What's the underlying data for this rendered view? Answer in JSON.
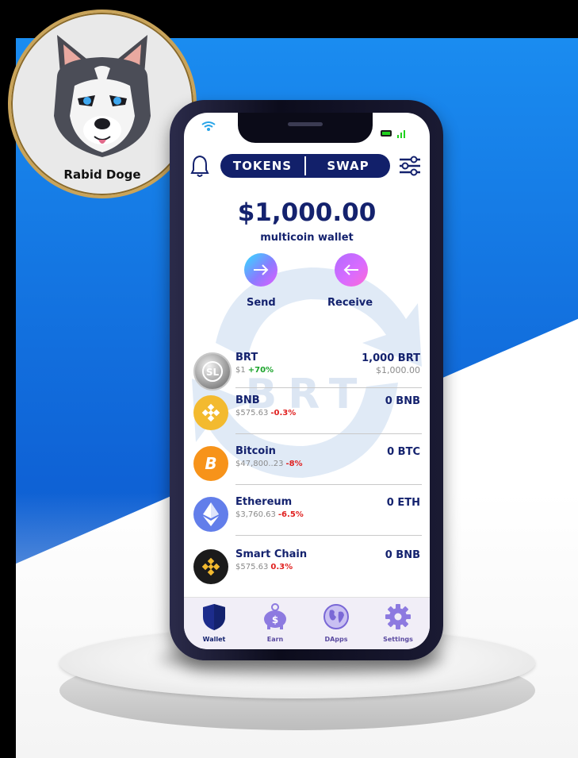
{
  "brand": {
    "logo_text": "Rabid Doge"
  },
  "header": {
    "tabs": [
      "TOKENS",
      "SWAP"
    ]
  },
  "wallet": {
    "balance": "$1,000.00",
    "subtitle": "multicoin wallet",
    "send_label": "Send",
    "receive_label": "Receive",
    "watermark": "BRT"
  },
  "tokens": [
    {
      "name": "BRT",
      "price": "$1",
      "change": "+70%",
      "change_color": "#1aa32a",
      "balance": "1,000 BRT",
      "value": "$1,000.00",
      "icon": "brt-coin-icon"
    },
    {
      "name": "BNB",
      "price": "$575.63",
      "change": "-0.3%",
      "change_color": "#e0201f",
      "balance": "0 BNB",
      "value": "",
      "icon": "bnb-coin-icon"
    },
    {
      "name": "Bitcoin",
      "price": "$47,800..23",
      "change": "-8%",
      "change_color": "#e0201f",
      "balance": "0 BTC",
      "value": "",
      "icon": "bitcoin-coin-icon"
    },
    {
      "name": "Ethereum",
      "price": "$3,760.63",
      "change": "-6.5%",
      "change_color": "#e0201f",
      "balance": "0 ETH",
      "value": "",
      "icon": "ethereum-coin-icon"
    },
    {
      "name": "Smart Chain",
      "price": "$575.63",
      "change": "0.3%",
      "change_color": "#e0201f",
      "balance": "0 BNB",
      "value": "",
      "icon": "smart-chain-coin-icon"
    }
  ],
  "nav": [
    {
      "label": "Wallet",
      "icon": "shield-icon",
      "active": true
    },
    {
      "label": "Earn",
      "icon": "piggy-bank-icon",
      "active": false
    },
    {
      "label": "DApps",
      "icon": "globe-icon",
      "active": false
    },
    {
      "label": "Settings",
      "icon": "gear-icon",
      "active": false
    }
  ],
  "colors": {
    "primary": "#14226e",
    "accent_blue": "#1a8cf0",
    "positive": "#1aa32a",
    "negative": "#e0201f"
  }
}
